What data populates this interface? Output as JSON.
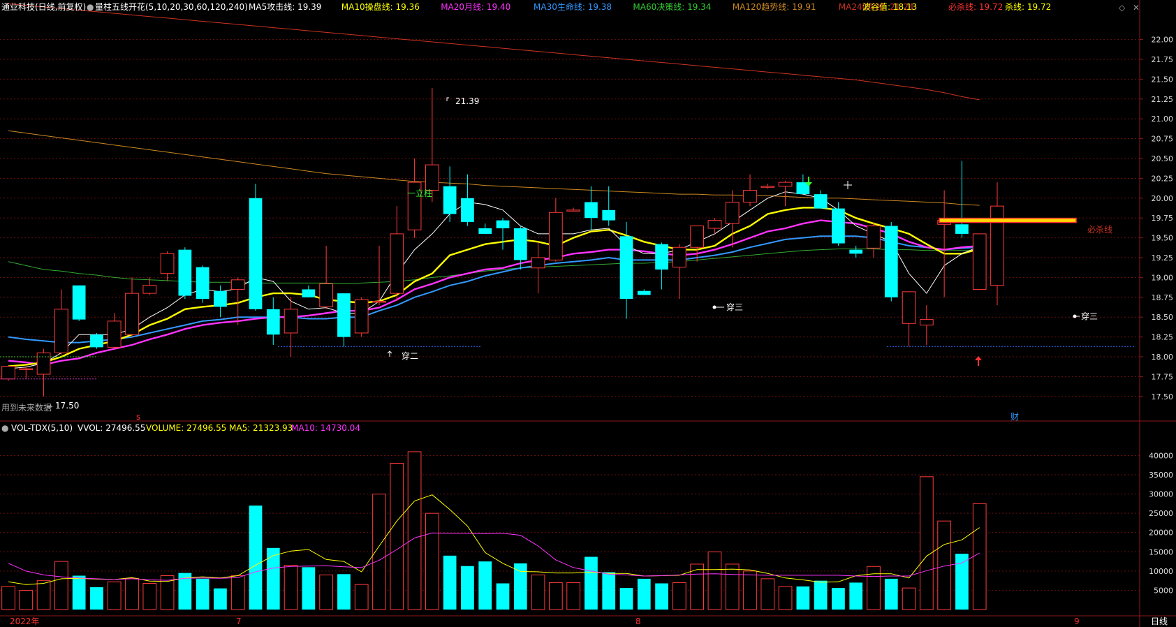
{
  "header": {
    "stock": "通业科技(日线,前复权)",
    "indicator": "量柱五线开花(5,10,20,30,60,120,240)",
    "items": [
      {
        "label": "MA5攻击线: 19.39",
        "color": "#ffffff"
      },
      {
        "label": "MA10操盘线: 19.36",
        "color": "#ffff00"
      },
      {
        "label": "MA20月线: 19.40",
        "color": "#ff33ff"
      },
      {
        "label": "MA30生命线: 19.38",
        "color": "#3399ff"
      },
      {
        "label": "MA60决策线: 19.34",
        "color": "#33cc33"
      },
      {
        "label": "MA120趋势线: 19.91",
        "color": "#cc8822"
      },
      {
        "label": "MA240年线: 21.24",
        "color": "#cc3322"
      }
    ],
    "wave_label": "波谷值: 18.13",
    "kill_must_label": "必杀线: 19.72",
    "kill_label": "杀线: 19.72"
  },
  "vol_header": {
    "name": "VOL-TDX(5,10)",
    "vvol": "VVOL: 27496.55",
    "volume": "VOLUME: 27496.55",
    "ma5": "MA5: 21323.93",
    "ma10": "MA10: 14730.04"
  },
  "annotations": {
    "high_label": "21.39",
    "low_label": "17.50",
    "future_label": "用到未来数据",
    "yili": "一立柱",
    "chuaner": "穿二",
    "chuansan1": "穿三",
    "chuansan2": "穿三",
    "bisha": "必杀线",
    "cai": "财",
    "s": "s"
  },
  "bottom": {
    "year": "2022年",
    "m7": "7",
    "m8": "8",
    "m9": "9",
    "period": "日线"
  },
  "chart_data": {
    "type": "candlestick",
    "price_ticks": [
      17.5,
      17.75,
      18.0,
      18.25,
      18.5,
      18.75,
      19.0,
      19.25,
      19.5,
      19.75,
      20.0,
      20.25,
      20.5,
      20.75,
      21.0,
      21.25,
      21.5,
      21.75,
      22.0
    ],
    "volume_ticks": [
      5000,
      10000,
      15000,
      20000,
      25000,
      30000,
      35000,
      40000
    ],
    "candles": [
      {
        "o": 17.72,
        "h": 17.88,
        "l": 17.7,
        "c": 17.88
      },
      {
        "o": 17.85,
        "h": 17.88,
        "l": 17.72,
        "c": 17.85
      },
      {
        "o": 17.78,
        "h": 18.1,
        "l": 17.5,
        "c": 18.05
      },
      {
        "o": 18.05,
        "h": 18.85,
        "l": 18.03,
        "c": 18.6
      },
      {
        "o": 18.9,
        "h": 18.9,
        "l": 18.45,
        "c": 18.47
      },
      {
        "o": 18.28,
        "h": 18.3,
        "l": 18.1,
        "c": 18.12
      },
      {
        "o": 18.12,
        "h": 18.55,
        "l": 18.1,
        "c": 18.45
      },
      {
        "o": 18.28,
        "h": 19.0,
        "l": 18.25,
        "c": 18.8
      },
      {
        "o": 18.8,
        "h": 19.0,
        "l": 18.78,
        "c": 18.9
      },
      {
        "o": 19.05,
        "h": 19.33,
        "l": 18.95,
        "c": 19.3
      },
      {
        "o": 19.35,
        "h": 19.38,
        "l": 18.73,
        "c": 18.77
      },
      {
        "o": 19.13,
        "h": 19.15,
        "l": 18.68,
        "c": 18.73
      },
      {
        "o": 18.83,
        "h": 18.9,
        "l": 18.5,
        "c": 18.63
      },
      {
        "o": 18.85,
        "h": 19.0,
        "l": 18.4,
        "c": 18.97
      },
      {
        "o": 20.0,
        "h": 20.18,
        "l": 18.58,
        "c": 18.6
      },
      {
        "o": 18.6,
        "h": 18.75,
        "l": 18.15,
        "c": 18.28
      },
      {
        "o": 18.3,
        "h": 18.75,
        "l": 18.0,
        "c": 18.6
      },
      {
        "o": 18.85,
        "h": 18.9,
        "l": 18.75,
        "c": 18.75
      },
      {
        "o": 18.63,
        "h": 19.4,
        "l": 18.6,
        "c": 18.92
      },
      {
        "o": 18.8,
        "h": 18.8,
        "l": 18.13,
        "c": 18.25
      },
      {
        "o": 18.3,
        "h": 18.75,
        "l": 18.25,
        "c": 18.72
      },
      {
        "o": 18.7,
        "h": 19.4,
        "l": 18.65,
        "c": 18.7
      },
      {
        "o": 18.8,
        "h": 19.9,
        "l": 18.7,
        "c": 19.55
      },
      {
        "o": 19.6,
        "h": 20.5,
        "l": 19.5,
        "c": 20.2
      },
      {
        "o": 20.1,
        "h": 21.39,
        "l": 19.95,
        "c": 20.42
      },
      {
        "o": 20.15,
        "h": 20.4,
        "l": 19.7,
        "c": 19.8
      },
      {
        "o": 20.0,
        "h": 20.3,
        "l": 19.65,
        "c": 19.7
      },
      {
        "o": 19.62,
        "h": 19.68,
        "l": 19.55,
        "c": 19.55
      },
      {
        "o": 19.72,
        "h": 19.75,
        "l": 19.35,
        "c": 19.62
      },
      {
        "o": 19.62,
        "h": 19.65,
        "l": 19.1,
        "c": 19.22
      },
      {
        "o": 19.12,
        "h": 19.45,
        "l": 18.8,
        "c": 19.25
      },
      {
        "o": 19.22,
        "h": 20.0,
        "l": 19.2,
        "c": 19.82
      },
      {
        "o": 19.85,
        "h": 19.88,
        "l": 19.83,
        "c": 19.85
      },
      {
        "o": 19.95,
        "h": 20.15,
        "l": 19.6,
        "c": 19.75
      },
      {
        "o": 19.85,
        "h": 20.15,
        "l": 19.65,
        "c": 19.72
      },
      {
        "o": 19.52,
        "h": 19.7,
        "l": 18.48,
        "c": 18.73
      },
      {
        "o": 18.83,
        "h": 18.85,
        "l": 18.78,
        "c": 18.78
      },
      {
        "o": 19.42,
        "h": 19.44,
        "l": 18.85,
        "c": 19.1
      },
      {
        "o": 19.13,
        "h": 19.42,
        "l": 18.73,
        "c": 19.38
      },
      {
        "o": 19.38,
        "h": 19.6,
        "l": 19.2,
        "c": 19.65
      },
      {
        "o": 19.62,
        "h": 19.75,
        "l": 19.55,
        "c": 19.72
      },
      {
        "o": 19.68,
        "h": 20.1,
        "l": 19.38,
        "c": 19.95
      },
      {
        "o": 19.95,
        "h": 20.3,
        "l": 19.9,
        "c": 20.1
      },
      {
        "o": 20.15,
        "h": 20.18,
        "l": 20.12,
        "c": 20.15
      },
      {
        "o": 20.15,
        "h": 20.22,
        "l": 19.9,
        "c": 20.2
      },
      {
        "o": 20.2,
        "h": 20.3,
        "l": 20.05,
        "c": 20.05
      },
      {
        "o": 20.05,
        "h": 20.1,
        "l": 19.88,
        "c": 19.87
      },
      {
        "o": 19.87,
        "h": 19.95,
        "l": 19.4,
        "c": 19.43
      },
      {
        "o": 19.35,
        "h": 19.4,
        "l": 19.25,
        "c": 19.3
      },
      {
        "o": 19.37,
        "h": 19.7,
        "l": 19.25,
        "c": 19.65
      },
      {
        "o": 19.65,
        "h": 19.7,
        "l": 18.7,
        "c": 18.75
      },
      {
        "o": 18.42,
        "h": 18.8,
        "l": 18.13,
        "c": 18.82
      },
      {
        "o": 18.4,
        "h": 18.65,
        "l": 18.15,
        "c": 18.47
      },
      {
        "o": 19.67,
        "h": 20.1,
        "l": 18.75,
        "c": 19.72
      },
      {
        "o": 19.67,
        "h": 20.47,
        "l": 19.5,
        "c": 19.55
      },
      {
        "o": 18.85,
        "h": 19.55,
        "l": 18.85,
        "c": 19.55
      },
      {
        "o": 18.9,
        "h": 20.2,
        "l": 18.65,
        "c": 19.9
      }
    ],
    "volumes": [
      6000,
      5000,
      7500,
      12500,
      8800,
      5800,
      7200,
      8100,
      6800,
      8800,
      9500,
      8000,
      5500,
      8800,
      27000,
      16000,
      11500,
      11000,
      9000,
      9200,
      6500,
      30000,
      38000,
      41000,
      25000,
      14000,
      11300,
      12500,
      6800,
      12000,
      9000,
      7000,
      7000,
      13700,
      9700,
      5600,
      8000,
      6800,
      7000,
      11800,
      15000,
      11800,
      10000,
      8000,
      6000,
      6000,
      7500,
      5600,
      7000,
      11200,
      8000,
      5600,
      34500,
      23000,
      14500,
      27500
    ],
    "vol_ma5": [
      7200,
      6500,
      6800,
      8000,
      8100,
      7900,
      7800,
      8300,
      7400,
      7300,
      8200,
      8500,
      8200,
      8800,
      11500,
      14000,
      15200,
      15600,
      13000,
      12500,
      9800,
      16500,
      23000,
      28200,
      29800,
      26000,
      21700,
      14800,
      12000,
      9900,
      9800,
      9500,
      9500,
      9700,
      9400,
      9400,
      8700,
      8800,
      8900,
      10400,
      10400,
      10500,
      10300,
      9400,
      8200,
      7700,
      7100,
      7200,
      8800,
      9300,
      9300,
      8200,
      13900,
      16900,
      18100,
      21300
    ],
    "vol_ma10": [
      12000,
      10000,
      9000,
      8500,
      8200,
      8000,
      7800,
      8000,
      7700,
      7600,
      8100,
      8200,
      8100,
      8300,
      9800,
      10800,
      11200,
      11300,
      11400,
      11100,
      10900,
      12800,
      15600,
      18600,
      19900,
      19800,
      19800,
      19700,
      19800,
      19300,
      16500,
      12900,
      10900,
      10000,
      9200,
      9000,
      8700,
      8800,
      9000,
      9200,
      9300,
      9100,
      9000,
      8900,
      8900,
      8900,
      8900,
      8900,
      8700,
      8600,
      8700,
      8700,
      10100,
      11300,
      12100,
      14700
    ],
    "ma5": [
      17.85,
      17.87,
      17.92,
      18.05,
      18.28,
      18.28,
      18.28,
      18.35,
      18.5,
      18.62,
      18.78,
      18.85,
      18.82,
      18.86,
      19.0,
      18.95,
      18.7,
      18.6,
      18.62,
      18.55,
      18.55,
      18.7,
      19.05,
      19.35,
      19.55,
      19.8,
      19.95,
      19.92,
      19.85,
      19.65,
      19.55,
      19.55,
      19.55,
      19.6,
      19.62,
      19.4,
      19.3,
      19.3,
      19.35,
      19.45,
      19.55,
      19.7,
      19.85,
      20.0,
      20.08,
      20.05,
      20.0,
      19.85,
      19.65,
      19.55,
      19.45,
      19.05,
      18.8,
      19.15,
      19.3,
      19.39
    ],
    "ma10": [
      17.88,
      17.9,
      17.93,
      18.0,
      18.1,
      18.15,
      18.2,
      18.28,
      18.4,
      18.48,
      18.6,
      18.63,
      18.65,
      18.68,
      18.75,
      18.8,
      18.8,
      18.78,
      18.72,
      18.7,
      18.68,
      18.7,
      18.78,
      18.95,
      19.05,
      19.28,
      19.35,
      19.42,
      19.45,
      19.48,
      19.45,
      19.4,
      19.5,
      19.58,
      19.6,
      19.53,
      19.45,
      19.4,
      19.35,
      19.35,
      19.4,
      19.55,
      19.65,
      19.8,
      19.85,
      19.88,
      19.88,
      19.85,
      19.75,
      19.68,
      19.62,
      19.55,
      19.42,
      19.3,
      19.3,
      19.36
    ],
    "ma20": [
      17.95,
      17.93,
      17.9,
      17.95,
      17.98,
      18.05,
      18.1,
      18.15,
      18.22,
      18.28,
      18.35,
      18.4,
      18.43,
      18.45,
      18.48,
      18.5,
      18.5,
      18.52,
      18.55,
      18.58,
      18.58,
      18.62,
      18.72,
      18.85,
      18.92,
      19.0,
      19.05,
      19.1,
      19.12,
      19.18,
      19.22,
      19.25,
      19.3,
      19.32,
      19.35,
      19.35,
      19.33,
      19.3,
      19.28,
      19.3,
      19.35,
      19.42,
      19.5,
      19.58,
      19.62,
      19.68,
      19.72,
      19.7,
      19.68,
      19.62,
      19.55,
      19.45,
      19.38,
      19.35,
      19.38,
      19.4
    ],
    "ma30": [
      18.25,
      18.22,
      18.2,
      18.18,
      18.18,
      18.2,
      18.22,
      18.25,
      18.3,
      18.35,
      18.4,
      18.45,
      18.47,
      18.5,
      18.5,
      18.5,
      18.5,
      18.48,
      18.48,
      18.5,
      18.5,
      18.58,
      18.65,
      18.75,
      18.82,
      18.9,
      18.95,
      19.02,
      19.07,
      19.12,
      19.15,
      19.18,
      19.2,
      19.22,
      19.25,
      19.22,
      19.22,
      19.22,
      19.22,
      19.25,
      19.28,
      19.32,
      19.38,
      19.43,
      19.48,
      19.5,
      19.52,
      19.52,
      19.52,
      19.5,
      19.45,
      19.4,
      19.38,
      19.35,
      19.37,
      19.38
    ],
    "ma60": [
      19.2,
      19.15,
      19.1,
      19.08,
      19.05,
      19.03,
      19.0,
      18.98,
      18.97,
      18.96,
      18.95,
      18.94,
      18.94,
      18.94,
      18.93,
      18.93,
      18.93,
      18.93,
      18.93,
      18.92,
      18.93,
      18.94,
      18.95,
      18.97,
      19.0,
      19.02,
      19.05,
      19.08,
      19.1,
      19.12,
      19.13,
      19.14,
      19.15,
      19.16,
      19.17,
      19.18,
      19.18,
      19.19,
      19.2,
      19.22,
      19.24,
      19.26,
      19.28,
      19.3,
      19.32,
      19.34,
      19.35,
      19.36,
      19.36,
      19.36,
      19.35,
      19.35,
      19.34,
      19.34,
      19.34,
      19.34
    ],
    "ma120": [
      20.85,
      20.82,
      20.79,
      20.76,
      20.73,
      20.7,
      20.67,
      20.64,
      20.61,
      20.58,
      20.55,
      20.52,
      20.49,
      20.46,
      20.43,
      20.4,
      20.37,
      20.34,
      20.31,
      20.29,
      20.27,
      20.25,
      20.23,
      20.21,
      20.2,
      20.19,
      20.18,
      20.16,
      20.15,
      20.14,
      20.13,
      20.12,
      20.11,
      20.1,
      20.09,
      20.08,
      20.07,
      20.06,
      20.05,
      20.05,
      20.04,
      20.04,
      20.03,
      20.03,
      20.02,
      20.01,
      20.0,
      20.0,
      19.99,
      19.98,
      19.97,
      19.96,
      19.95,
      19.94,
      19.92,
      19.91
    ],
    "ma240": [
      22.45,
      22.43,
      22.41,
      22.39,
      22.37,
      22.35,
      22.33,
      22.31,
      22.29,
      22.27,
      22.25,
      22.23,
      22.21,
      22.19,
      22.17,
      22.15,
      22.13,
      22.11,
      22.09,
      22.07,
      22.05,
      22.03,
      22.01,
      21.99,
      21.97,
      21.95,
      21.93,
      21.91,
      21.89,
      21.87,
      21.85,
      21.83,
      21.81,
      21.79,
      21.77,
      21.75,
      21.73,
      21.71,
      21.69,
      21.67,
      21.65,
      21.63,
      21.61,
      21.59,
      21.57,
      21.55,
      21.53,
      21.51,
      21.49,
      21.46,
      21.43,
      21.4,
      21.37,
      21.33,
      21.28,
      21.24
    ]
  }
}
